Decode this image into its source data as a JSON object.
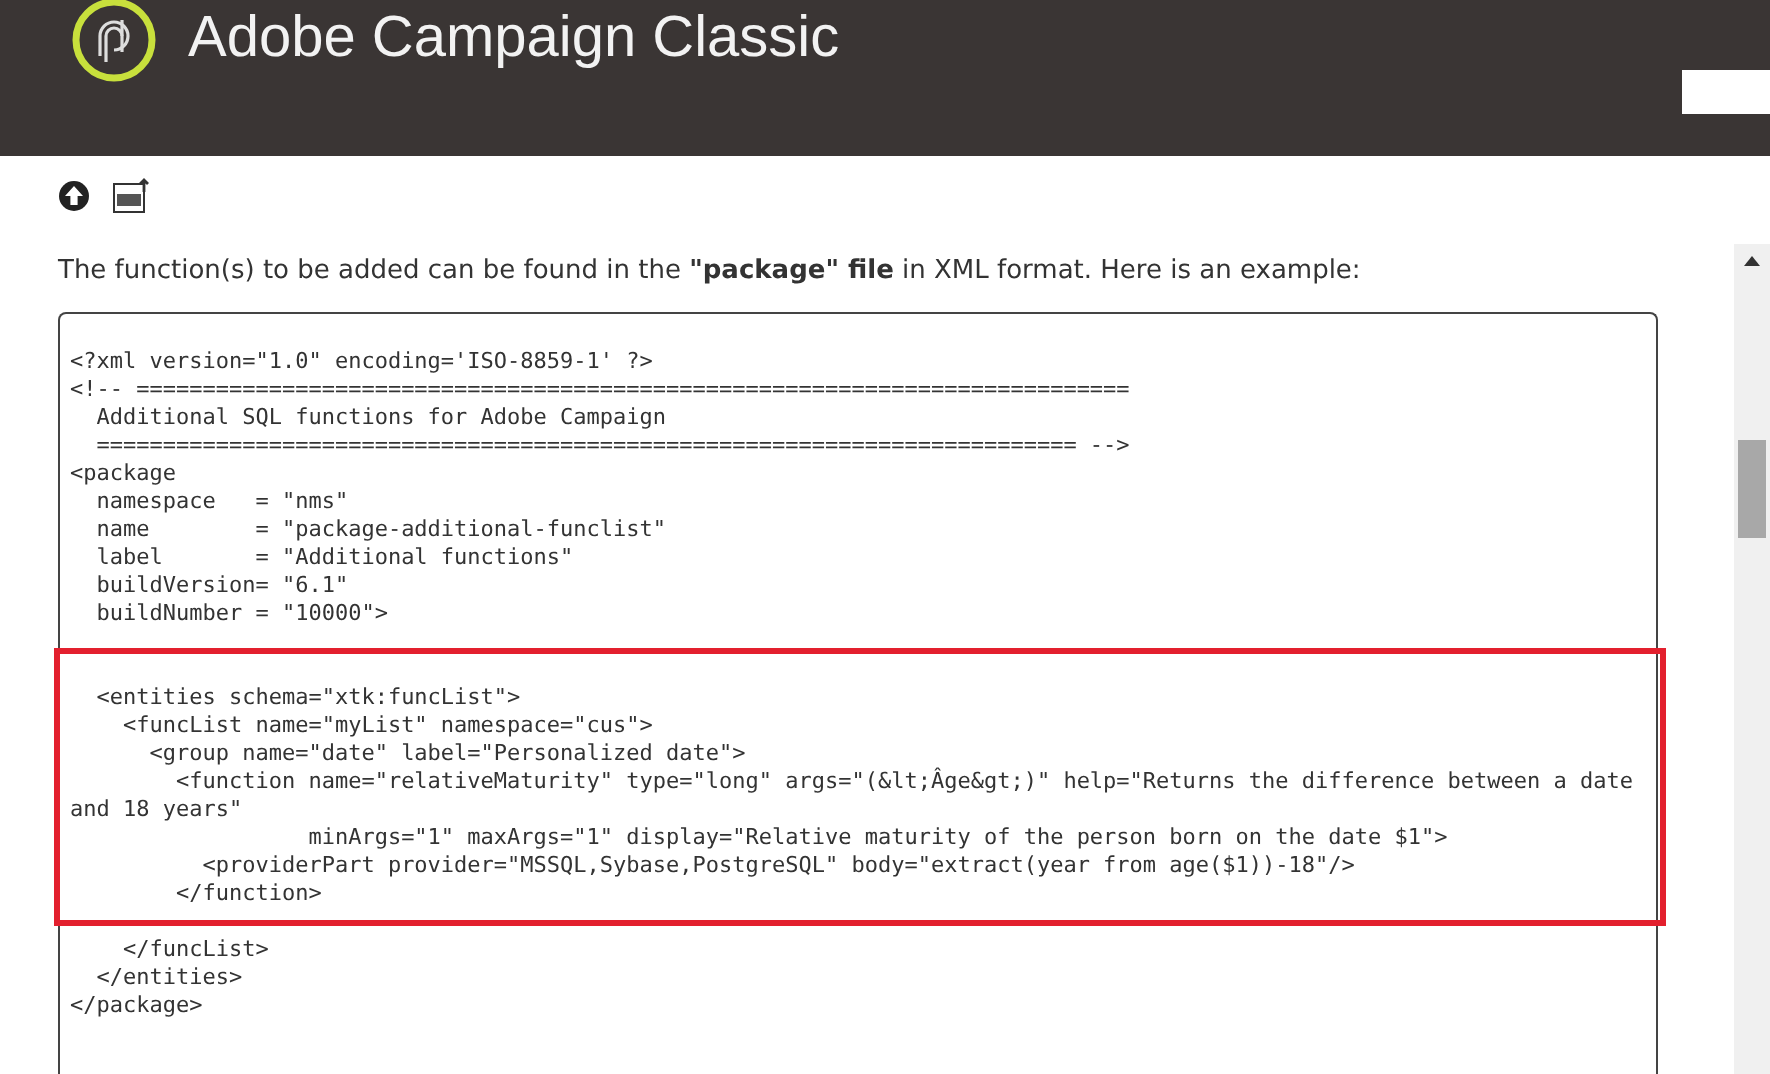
{
  "header": {
    "title": "Adobe Campaign Classic"
  },
  "intro": "The function(s) to be added can be found in the **\"package\" file** in XML format. Here is an example:",
  "code_head": [
    "<?xml version=\"1.0\" encoding='ISO-8859-1' ?>",
    "<!-- ===========================================================================",
    "  Additional SQL functions for Adobe Campaign",
    "  ========================================================================== -->",
    "<package",
    "  namespace   = \"nms\"",
    "  name        = \"package-additional-funclist\"",
    "  label       = \"Additional functions\"",
    "  buildVersion= \"6.1\"",
    "  buildNumber = \"10000\">"
  ],
  "code_highlighted": [
    "  <entities schema=\"xtk:funcList\">",
    "    <funcList name=\"myList\" namespace=\"cus\">",
    "      <group name=\"date\" label=\"Personalized date\">",
    "        <function name=\"relativeMaturity\" type=\"long\" args=\"(&lt;Âge&gt;)\" help=\"Returns the difference between a date",
    "and 18 years\"",
    "                  minArgs=\"1\" maxArgs=\"1\" display=\"Relative maturity of the person born on the date $1\">",
    "          <providerPart provider=\"MSSQL,Sybase,PostgreSQL\" body=\"extract(year from age($1))-18\"/>",
    "        </function>"
  ],
  "code_tail": [
    "    </funcList>",
    "  </entities>",
    "</package>"
  ]
}
